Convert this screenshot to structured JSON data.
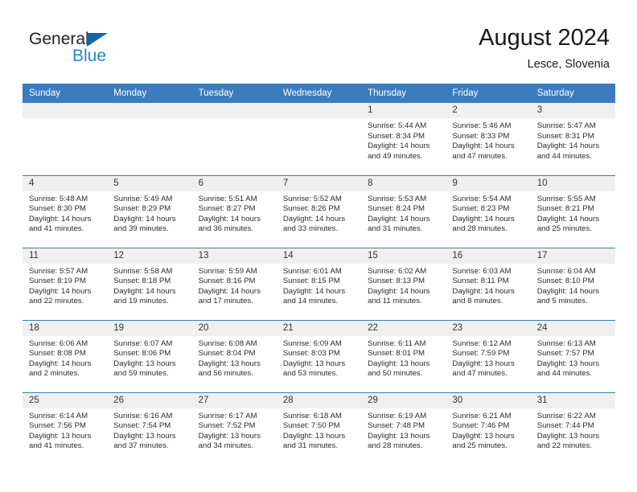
{
  "brand": {
    "name_top": "General",
    "name_bottom": "Blue",
    "accent_color": "#2585d3",
    "triangle_color": "#1464aa"
  },
  "header": {
    "title": "August 2024",
    "subtitle": "Lesce, Slovenia"
  },
  "calendar": {
    "header_bg": "#3a7cbe",
    "daynum_bg": "#efefef",
    "weekday_headers": [
      "Sunday",
      "Monday",
      "Tuesday",
      "Wednesday",
      "Thursday",
      "Friday",
      "Saturday"
    ],
    "weeks": [
      [
        {
          "day": "",
          "blank": true,
          "sunrise": "",
          "sunset": "",
          "daylight_line1": "",
          "daylight_line2": ""
        },
        {
          "day": "",
          "blank": true,
          "sunrise": "",
          "sunset": "",
          "daylight_line1": "",
          "daylight_line2": ""
        },
        {
          "day": "",
          "blank": true,
          "sunrise": "",
          "sunset": "",
          "daylight_line1": "",
          "daylight_line2": ""
        },
        {
          "day": "",
          "blank": true,
          "sunrise": "",
          "sunset": "",
          "daylight_line1": "",
          "daylight_line2": ""
        },
        {
          "day": "1",
          "blank": false,
          "sunrise": "Sunrise: 5:44 AM",
          "sunset": "Sunset: 8:34 PM",
          "daylight_line1": "Daylight: 14 hours",
          "daylight_line2": "and 49 minutes."
        },
        {
          "day": "2",
          "blank": false,
          "sunrise": "Sunrise: 5:46 AM",
          "sunset": "Sunset: 8:33 PM",
          "daylight_line1": "Daylight: 14 hours",
          "daylight_line2": "and 47 minutes."
        },
        {
          "day": "3",
          "blank": false,
          "sunrise": "Sunrise: 5:47 AM",
          "sunset": "Sunset: 8:31 PM",
          "daylight_line1": "Daylight: 14 hours",
          "daylight_line2": "and 44 minutes."
        }
      ],
      [
        {
          "day": "4",
          "blank": false,
          "sunrise": "Sunrise: 5:48 AM",
          "sunset": "Sunset: 8:30 PM",
          "daylight_line1": "Daylight: 14 hours",
          "daylight_line2": "and 41 minutes."
        },
        {
          "day": "5",
          "blank": false,
          "sunrise": "Sunrise: 5:49 AM",
          "sunset": "Sunset: 8:29 PM",
          "daylight_line1": "Daylight: 14 hours",
          "daylight_line2": "and 39 minutes."
        },
        {
          "day": "6",
          "blank": false,
          "sunrise": "Sunrise: 5:51 AM",
          "sunset": "Sunset: 8:27 PM",
          "daylight_line1": "Daylight: 14 hours",
          "daylight_line2": "and 36 minutes."
        },
        {
          "day": "7",
          "blank": false,
          "sunrise": "Sunrise: 5:52 AM",
          "sunset": "Sunset: 8:26 PM",
          "daylight_line1": "Daylight: 14 hours",
          "daylight_line2": "and 33 minutes."
        },
        {
          "day": "8",
          "blank": false,
          "sunrise": "Sunrise: 5:53 AM",
          "sunset": "Sunset: 8:24 PM",
          "daylight_line1": "Daylight: 14 hours",
          "daylight_line2": "and 31 minutes."
        },
        {
          "day": "9",
          "blank": false,
          "sunrise": "Sunrise: 5:54 AM",
          "sunset": "Sunset: 8:23 PM",
          "daylight_line1": "Daylight: 14 hours",
          "daylight_line2": "and 28 minutes."
        },
        {
          "day": "10",
          "blank": false,
          "sunrise": "Sunrise: 5:55 AM",
          "sunset": "Sunset: 8:21 PM",
          "daylight_line1": "Daylight: 14 hours",
          "daylight_line2": "and 25 minutes."
        }
      ],
      [
        {
          "day": "11",
          "blank": false,
          "sunrise": "Sunrise: 5:57 AM",
          "sunset": "Sunset: 8:19 PM",
          "daylight_line1": "Daylight: 14 hours",
          "daylight_line2": "and 22 minutes."
        },
        {
          "day": "12",
          "blank": false,
          "sunrise": "Sunrise: 5:58 AM",
          "sunset": "Sunset: 8:18 PM",
          "daylight_line1": "Daylight: 14 hours",
          "daylight_line2": "and 19 minutes."
        },
        {
          "day": "13",
          "blank": false,
          "sunrise": "Sunrise: 5:59 AM",
          "sunset": "Sunset: 8:16 PM",
          "daylight_line1": "Daylight: 14 hours",
          "daylight_line2": "and 17 minutes."
        },
        {
          "day": "14",
          "blank": false,
          "sunrise": "Sunrise: 6:01 AM",
          "sunset": "Sunset: 8:15 PM",
          "daylight_line1": "Daylight: 14 hours",
          "daylight_line2": "and 14 minutes."
        },
        {
          "day": "15",
          "blank": false,
          "sunrise": "Sunrise: 6:02 AM",
          "sunset": "Sunset: 8:13 PM",
          "daylight_line1": "Daylight: 14 hours",
          "daylight_line2": "and 11 minutes."
        },
        {
          "day": "16",
          "blank": false,
          "sunrise": "Sunrise: 6:03 AM",
          "sunset": "Sunset: 8:11 PM",
          "daylight_line1": "Daylight: 14 hours",
          "daylight_line2": "and 8 minutes."
        },
        {
          "day": "17",
          "blank": false,
          "sunrise": "Sunrise: 6:04 AM",
          "sunset": "Sunset: 8:10 PM",
          "daylight_line1": "Daylight: 14 hours",
          "daylight_line2": "and 5 minutes."
        }
      ],
      [
        {
          "day": "18",
          "blank": false,
          "sunrise": "Sunrise: 6:06 AM",
          "sunset": "Sunset: 8:08 PM",
          "daylight_line1": "Daylight: 14 hours",
          "daylight_line2": "and 2 minutes."
        },
        {
          "day": "19",
          "blank": false,
          "sunrise": "Sunrise: 6:07 AM",
          "sunset": "Sunset: 8:06 PM",
          "daylight_line1": "Daylight: 13 hours",
          "daylight_line2": "and 59 minutes."
        },
        {
          "day": "20",
          "blank": false,
          "sunrise": "Sunrise: 6:08 AM",
          "sunset": "Sunset: 8:04 PM",
          "daylight_line1": "Daylight: 13 hours",
          "daylight_line2": "and 56 minutes."
        },
        {
          "day": "21",
          "blank": false,
          "sunrise": "Sunrise: 6:09 AM",
          "sunset": "Sunset: 8:03 PM",
          "daylight_line1": "Daylight: 13 hours",
          "daylight_line2": "and 53 minutes."
        },
        {
          "day": "22",
          "blank": false,
          "sunrise": "Sunrise: 6:11 AM",
          "sunset": "Sunset: 8:01 PM",
          "daylight_line1": "Daylight: 13 hours",
          "daylight_line2": "and 50 minutes."
        },
        {
          "day": "23",
          "blank": false,
          "sunrise": "Sunrise: 6:12 AM",
          "sunset": "Sunset: 7:59 PM",
          "daylight_line1": "Daylight: 13 hours",
          "daylight_line2": "and 47 minutes."
        },
        {
          "day": "24",
          "blank": false,
          "sunrise": "Sunrise: 6:13 AM",
          "sunset": "Sunset: 7:57 PM",
          "daylight_line1": "Daylight: 13 hours",
          "daylight_line2": "and 44 minutes."
        }
      ],
      [
        {
          "day": "25",
          "blank": false,
          "sunrise": "Sunrise: 6:14 AM",
          "sunset": "Sunset: 7:56 PM",
          "daylight_line1": "Daylight: 13 hours",
          "daylight_line2": "and 41 minutes."
        },
        {
          "day": "26",
          "blank": false,
          "sunrise": "Sunrise: 6:16 AM",
          "sunset": "Sunset: 7:54 PM",
          "daylight_line1": "Daylight: 13 hours",
          "daylight_line2": "and 37 minutes."
        },
        {
          "day": "27",
          "blank": false,
          "sunrise": "Sunrise: 6:17 AM",
          "sunset": "Sunset: 7:52 PM",
          "daylight_line1": "Daylight: 13 hours",
          "daylight_line2": "and 34 minutes."
        },
        {
          "day": "28",
          "blank": false,
          "sunrise": "Sunrise: 6:18 AM",
          "sunset": "Sunset: 7:50 PM",
          "daylight_line1": "Daylight: 13 hours",
          "daylight_line2": "and 31 minutes."
        },
        {
          "day": "29",
          "blank": false,
          "sunrise": "Sunrise: 6:19 AM",
          "sunset": "Sunset: 7:48 PM",
          "daylight_line1": "Daylight: 13 hours",
          "daylight_line2": "and 28 minutes."
        },
        {
          "day": "30",
          "blank": false,
          "sunrise": "Sunrise: 6:21 AM",
          "sunset": "Sunset: 7:46 PM",
          "daylight_line1": "Daylight: 13 hours",
          "daylight_line2": "and 25 minutes."
        },
        {
          "day": "31",
          "blank": false,
          "sunrise": "Sunrise: 6:22 AM",
          "sunset": "Sunset: 7:44 PM",
          "daylight_line1": "Daylight: 13 hours",
          "daylight_line2": "and 22 minutes."
        }
      ]
    ]
  }
}
